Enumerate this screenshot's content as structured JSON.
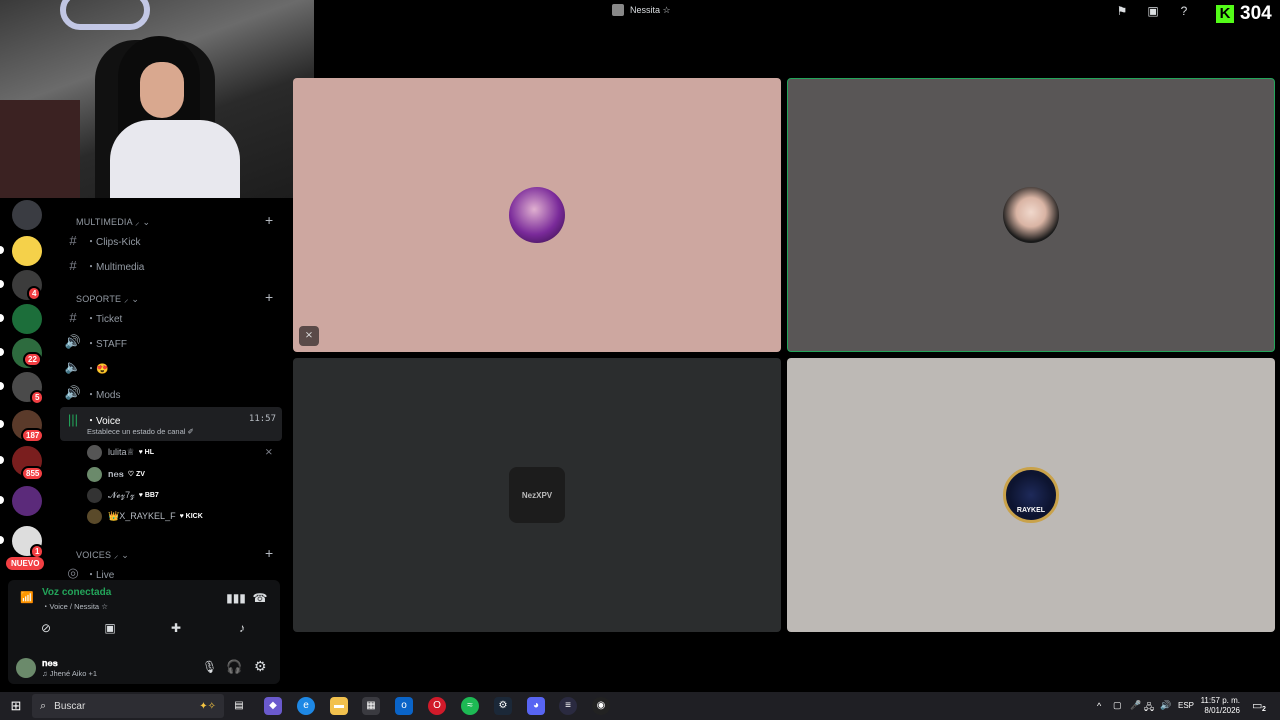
{
  "top": {
    "call_title": "Nessita ☆",
    "kick_count": "304",
    "kick_logo": "K"
  },
  "servers": [
    {
      "badge": ""
    },
    {
      "badge": ""
    },
    {
      "badge": "4"
    },
    {
      "badge": ""
    },
    {
      "badge": "22"
    },
    {
      "badge": "5"
    },
    {
      "badge": "187"
    },
    {
      "badge": "855"
    },
    {
      "badge": ""
    },
    {
      "badge": "1"
    }
  ],
  "server_new_label": "NUEVO",
  "channels": {
    "cat_multimedia": "MULTIMEDIA ⸝ ⌄",
    "clips_kick": "・Clips-Kick",
    "multimedia": "・Multimedia",
    "cat_soporte": "SOPORTE ⸝ ⌄",
    "ticket": "・Ticket",
    "staff": "・STAFF",
    "emoji_channel": "・😍",
    "mods": "・Mods",
    "voice": "・Voice",
    "voice_time": "11:57",
    "voice_status": "Establece un estado de canal ✐",
    "cat_voices": "VOICES ⸝ ⌄",
    "live": "・Live",
    "add": "+"
  },
  "voice_users": [
    {
      "name": "lulita♕",
      "tag": "♥ HL"
    },
    {
      "name": "𝐧𝐞𝐬",
      "tag": "♡ ZV"
    },
    {
      "name": "𝓝𝓮𝔃7𝔃",
      "tag": "♥ BB7"
    },
    {
      "name": "👑X_RAYKEL_F",
      "tag": "♥ KICK"
    }
  ],
  "panel": {
    "voice_connected": "Voz conectada",
    "voice_path": "・Voice / Nessita ☆",
    "username": "𝐧𝐞𝐬",
    "activity": "♫ Jhené Aiko +1"
  },
  "tiles": {
    "tile3_avatar_text": "NezXPV",
    "tile4_avatar_text": "RAYKEL"
  },
  "taskbar": {
    "search_placeholder": "Buscar",
    "lang": "ESP",
    "time": "11:57 p. m.",
    "date": "8/01/2026",
    "notifications": "2"
  },
  "colors": {
    "accent_green": "#23a55a",
    "kick_green": "#53fc18",
    "badge_red": "#f23f43"
  }
}
